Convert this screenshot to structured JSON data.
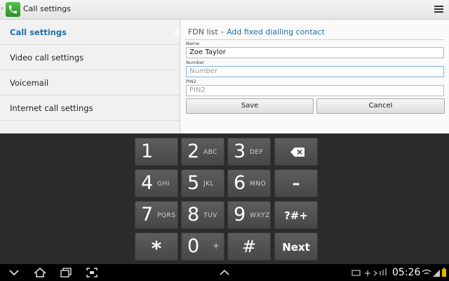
{
  "header": {
    "title": "Call settings",
    "back_glyph": "‹",
    "app_icon": "phone-icon",
    "menu_icon": "menu-icon"
  },
  "sidebar": {
    "items": [
      {
        "label": "Call settings",
        "active": true
      },
      {
        "label": "Video call settings",
        "active": false
      },
      {
        "label": "Voicemail",
        "active": false
      },
      {
        "label": "Internet call settings",
        "active": false
      }
    ]
  },
  "content": {
    "breadcrumb": {
      "parent": "FDN list",
      "separator": "›",
      "current": "Add fixed dialling contact"
    },
    "name": {
      "label": "Name",
      "value": "Zoe Taylor"
    },
    "number": {
      "label": "Number",
      "value": "",
      "placeholder": "Number"
    },
    "pin2": {
      "label": "PIN2",
      "value": "",
      "placeholder": "PIN2"
    },
    "save_label": "Save",
    "cancel_label": "Cancel"
  },
  "keypad": {
    "k1": {
      "digit": "1",
      "letters": ""
    },
    "k2": {
      "digit": "2",
      "letters": "ABC"
    },
    "k3": {
      "digit": "3",
      "letters": "DEF"
    },
    "k4": {
      "digit": "4",
      "letters": "GHI"
    },
    "k5": {
      "digit": "5",
      "letters": "JKL"
    },
    "k6": {
      "digit": "6",
      "letters": "MNO"
    },
    "k7": {
      "digit": "7",
      "letters": "PQRS"
    },
    "k8": {
      "digit": "8",
      "letters": "TUV"
    },
    "k9": {
      "digit": "9",
      "letters": "WXYZ"
    },
    "k0": {
      "digit": "0",
      "letters": "+"
    },
    "star": "*",
    "hash": "#",
    "minus": "–",
    "symbols": "?#+",
    "next": "Next",
    "backspace_icon": "backspace-icon"
  },
  "statusbar": {
    "time": "05:26"
  },
  "colors": {
    "accent": "#1f6ea8",
    "key": "#525252",
    "keyboard_bg": "#2b2b2b",
    "header_bg": "#ececec"
  }
}
